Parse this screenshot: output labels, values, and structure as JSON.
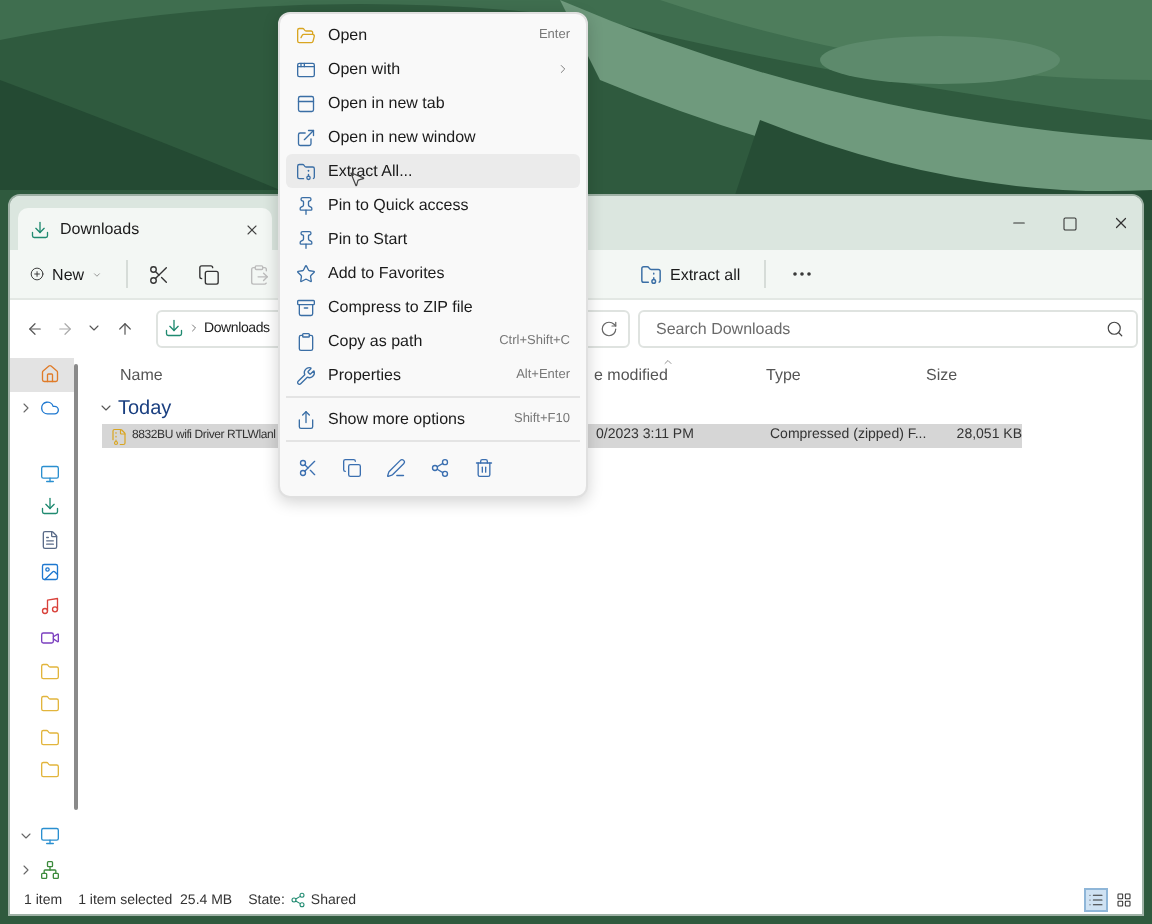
{
  "window": {
    "tab": {
      "title": "Downloads",
      "selected": true
    }
  },
  "toolbar": {
    "new_button": "New",
    "clipboard_buttons": [
      {
        "disabled": false
      },
      {
        "disabled": false
      },
      {
        "disabled": true
      }
    ],
    "extract_button": "Extract all"
  },
  "address_bar": {
    "breadcrumb": [
      "Downloads"
    ]
  },
  "search": {
    "placeholder": "Search Downloads"
  },
  "nav_pane": {
    "items": [
      {
        "selected": true
      },
      {
        "selected": false,
        "expanded": false
      },
      {
        "selected": false
      },
      {
        "selected": false
      },
      {
        "selected": false
      },
      {
        "selected": false
      },
      {
        "selected": false
      },
      {
        "selected": false
      },
      {
        "selected": false
      },
      {
        "selected": false
      },
      {
        "selected": false
      },
      {
        "selected": false
      },
      {
        "selected": false,
        "expanded": true
      },
      {
        "selected": false,
        "expanded": false
      }
    ]
  },
  "file_list": {
    "columns": [
      {
        "label": "Name",
        "sorted": false
      },
      {
        "label": "e modified",
        "sorted": true
      },
      {
        "label": "Type",
        "sorted": false
      },
      {
        "label": "Size",
        "sorted": false
      }
    ],
    "group": {
      "label": "Today",
      "expanded": true
    },
    "rows": [
      {
        "name": "8832BU wifi Driver RTLWlanl",
        "date": "0/2023 3:11 PM",
        "type": "Compressed (zipped) F...",
        "size": "28,051 KB",
        "selected": true
      }
    ]
  },
  "status_bar": {
    "item_count": "1 item",
    "selection": "1 item selected  25.4 MB",
    "state_label": "State:",
    "state_value": "Shared"
  },
  "view_buttons": [
    {
      "selected": true
    },
    {
      "selected": false
    }
  ],
  "context_menu": {
    "items": [
      {
        "label": "Open",
        "shortcut": "Enter",
        "submenu": false,
        "highlighted": false
      },
      {
        "label": "Open with",
        "submenu": true,
        "highlighted": false
      },
      {
        "label": "Open in new tab",
        "submenu": false,
        "highlighted": false
      },
      {
        "label": "Open in new window",
        "submenu": false,
        "highlighted": false
      },
      {
        "label": "Extract All...",
        "submenu": false,
        "highlighted": true
      },
      {
        "label": "Pin to Quick access",
        "submenu": false,
        "highlighted": false
      },
      {
        "label": "Pin to Start",
        "submenu": false,
        "highlighted": false
      },
      {
        "label": "Add to Favorites",
        "submenu": false,
        "highlighted": false
      },
      {
        "label": "Compress to ZIP file",
        "submenu": false,
        "highlighted": false
      },
      {
        "label": "Copy as path",
        "shortcut": "Ctrl+Shift+C",
        "submenu": false,
        "highlighted": false
      },
      {
        "label": "Properties",
        "shortcut": "Alt+Enter",
        "submenu": false,
        "highlighted": false
      }
    ],
    "more_options": {
      "label": "Show more options",
      "shortcut": "Shift+F10",
      "highlighted": false
    }
  }
}
